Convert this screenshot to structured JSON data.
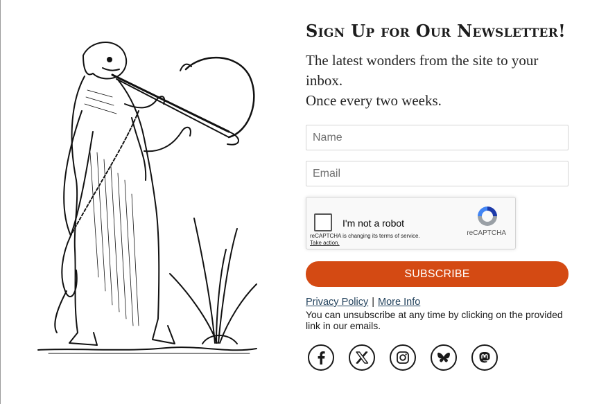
{
  "newsletter": {
    "heading": "Sign Up for Our Newsletter!",
    "intro_line1": "The latest wonders from the site to your inbox.",
    "intro_line2": "Once every two weeks.",
    "name_placeholder": "Name",
    "email_placeholder": "Email",
    "subscribe_label": "SUBSCRIBE",
    "privacy_label": "Privacy Policy",
    "separator": "|",
    "more_info_label": "More Info",
    "unsubscribe_text": "You can unsubscribe at any time by clicking on the provided link in our emails."
  },
  "captcha": {
    "label": "I'm not a robot",
    "notice": "reCAPTCHA is changing its terms of service.",
    "action_link": "Take action.",
    "brand": "reCAPTCHA"
  },
  "social": [
    {
      "name": "facebook-icon"
    },
    {
      "name": "x-icon"
    },
    {
      "name": "instagram-icon"
    },
    {
      "name": "bluesky-icon"
    },
    {
      "name": "mastodon-icon"
    }
  ],
  "colors": {
    "accent": "#d44a13",
    "link": "#1f3f5a",
    "text": "#1a1a1a"
  }
}
